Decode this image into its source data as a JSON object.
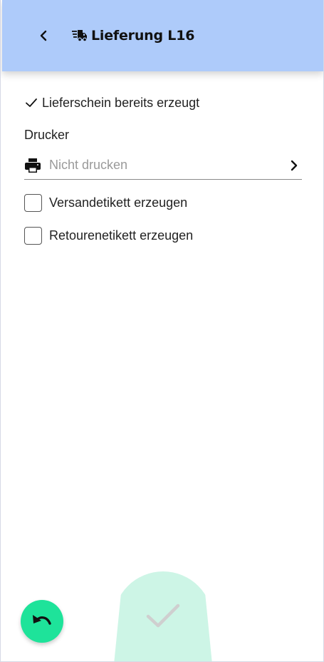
{
  "header": {
    "title": "Lieferung L16",
    "back_icon": "chevron-left-icon",
    "title_icon": "fast-delivery-truck-icon",
    "background": "#aecbfa"
  },
  "status": {
    "icon": "check-icon",
    "text": "Lieferschein bereits erzeugt"
  },
  "printer": {
    "label": "Drucker",
    "icon": "printer-icon",
    "placeholder": "Nicht drucken",
    "chevron_icon": "chevron-right-icon"
  },
  "options": [
    {
      "label": "Versandetikett erzeugen",
      "checked": false
    },
    {
      "label": "Retourenetikett erzeugen",
      "checked": false
    }
  ],
  "actions": {
    "undo_icon": "undo-icon",
    "undo_color": "#1ee39a",
    "confirm_icon": "check-icon",
    "confirm_color": "#cdf5e6"
  }
}
